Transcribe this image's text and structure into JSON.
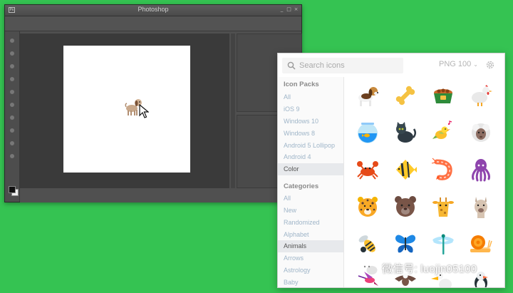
{
  "photoshop": {
    "title": "Photoshop",
    "ps_logo_glyph": "Ps",
    "window_controls": [
      "_",
      "□",
      "×"
    ]
  },
  "icons_panel": {
    "search": {
      "placeholder": "Search icons",
      "value": ""
    },
    "format": {
      "label": "PNG 100",
      "chevron": "⌄"
    },
    "icon_packs": {
      "heading": "Icon Packs",
      "items": [
        "All",
        "iOS 9",
        "Windows 10",
        "Windows 8",
        "Android 5 Lollipop",
        "Android 4",
        "Color"
      ],
      "selected": "Color"
    },
    "categories": {
      "heading": "Categories",
      "items": [
        "All",
        "New",
        "Randomized",
        "Alphabet",
        "Animals",
        "Arrows",
        "Astrology",
        "Baby"
      ],
      "selected": "Animals"
    },
    "icons": [
      "dog-icon",
      "bone-icon",
      "pet-food-bowl-icon",
      "chicken-icon",
      "aquarium-icon",
      "cat-icon",
      "singing-bird-icon",
      "sheep-icon",
      "crab-icon",
      "tropical-fish-icon",
      "shrimp-icon",
      "octopus-icon",
      "leopard-icon",
      "bear-icon",
      "giraffe-icon",
      "llama-icon",
      "wasp-icon",
      "butterfly-icon",
      "dragonfly-icon",
      "snail-icon",
      "hummingbird-icon",
      "eagle-icon",
      "pelican-icon",
      "puffin-icon"
    ]
  },
  "watermark": {
    "text": "微信号: luojin05100"
  },
  "colors": {
    "background": "#35c352",
    "sidebar_link": "#9fb5c8",
    "selected_row": "#e7e9ec"
  }
}
